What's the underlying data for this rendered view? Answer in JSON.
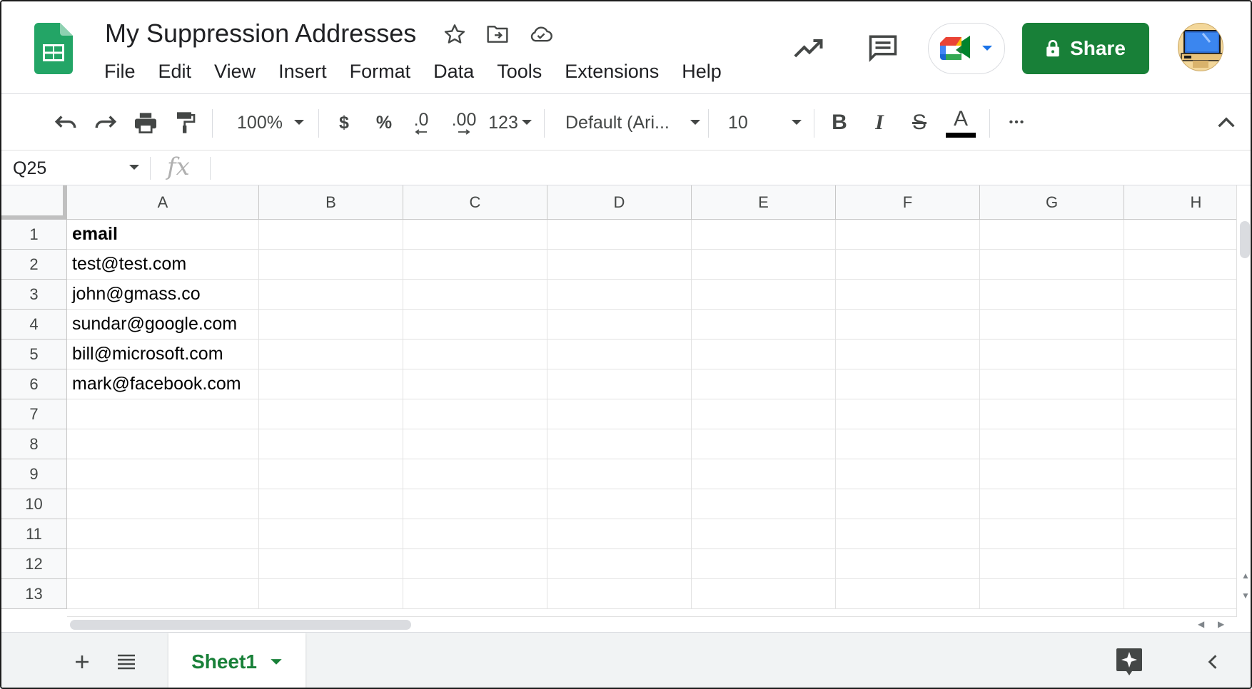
{
  "app": {
    "doc_title": "My Suppression Addresses",
    "brand_color": "#188038"
  },
  "menu": [
    "File",
    "Edit",
    "View",
    "Insert",
    "Format",
    "Data",
    "Tools",
    "Extensions",
    "Help"
  ],
  "header": {
    "share_label": "Share",
    "icons": [
      "star-icon",
      "move-folder-icon",
      "cloud-saved-icon",
      "activity-trend-icon",
      "comments-icon",
      "meet-icon",
      "lock-icon",
      "avatar"
    ]
  },
  "toolbar": {
    "zoom": "100%",
    "currency": "$",
    "percent": "%",
    "decrease_decimal": ".0",
    "increase_decimal": ".00",
    "more_formats": "123",
    "font": "Default (Ari...",
    "font_size": "10",
    "bold": "B",
    "italic": "I",
    "strike": "S",
    "text_color": "A",
    "more": "•••"
  },
  "formula": {
    "name_box": "Q25",
    "fx": "fx",
    "value": ""
  },
  "grid": {
    "columns": [
      "A",
      "B",
      "C",
      "D",
      "E",
      "F",
      "G",
      "H"
    ],
    "rows": [
      "1",
      "2",
      "3",
      "4",
      "5",
      "6",
      "7",
      "8",
      "9",
      "10",
      "11",
      "12",
      "13"
    ],
    "column_a": [
      "email",
      "test@test.com",
      "john@gmass.co",
      "sundar@google.com",
      "bill@microsoft.com",
      "mark@facebook.com",
      "",
      "",
      "",
      "",
      "",
      "",
      ""
    ]
  },
  "sheets": {
    "active": "Sheet1"
  }
}
